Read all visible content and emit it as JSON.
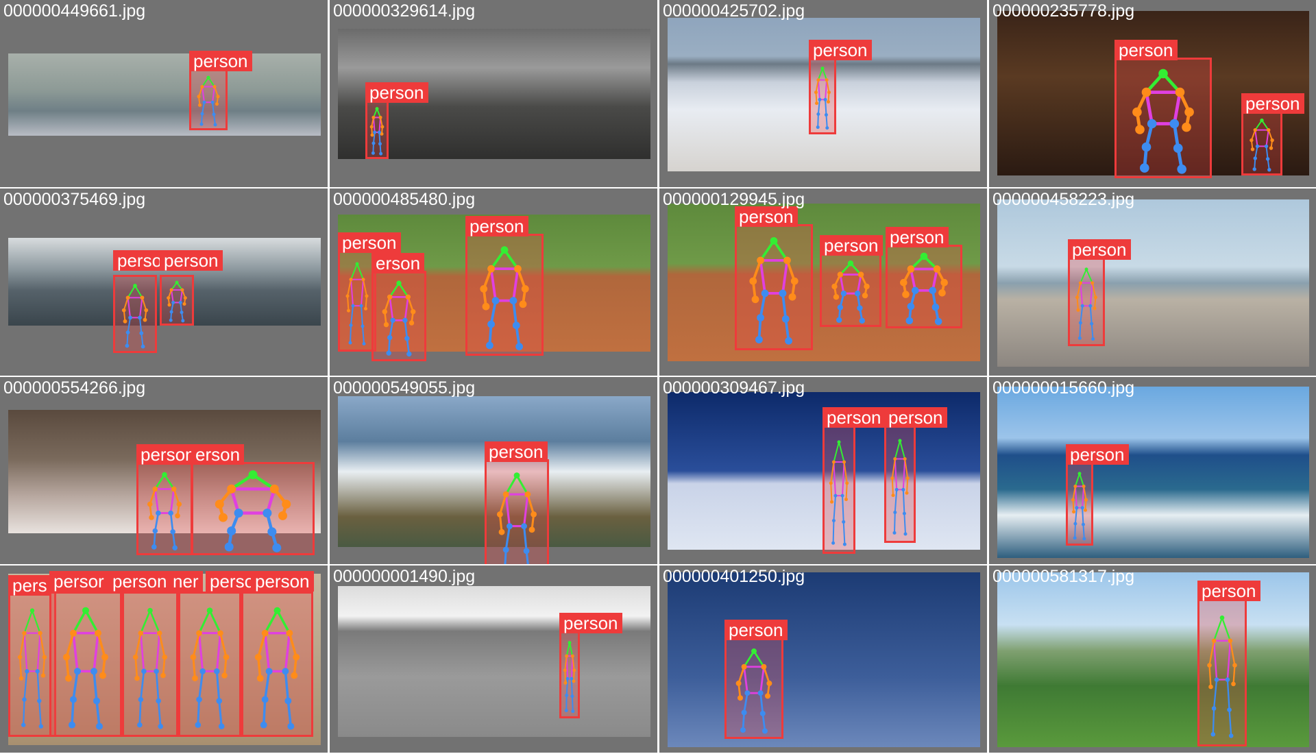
{
  "colors": {
    "background": "#ffffff",
    "tile": "#727272",
    "box": "#ee3b3b",
    "label_text": "#ffffff",
    "kp_face": "#33ee33",
    "kp_arm": "#ff8c1a",
    "kp_leg": "#3d8cf0",
    "kp_torso": "#e040e0"
  },
  "tiles": [
    {
      "filename": "000000449661.jpg",
      "scene": "hospital-room",
      "detections": [
        {
          "label": "person"
        }
      ]
    },
    {
      "filename": "000000329614.jpg",
      "scene": "cathedral-street",
      "detections": [
        {
          "label": "person"
        }
      ]
    },
    {
      "filename": "000000425702.jpg",
      "scene": "beach-surfboard",
      "detections": [
        {
          "label": "person"
        }
      ]
    },
    {
      "filename": "000000235778.jpg",
      "scene": "kites-bunting",
      "detections": [
        {
          "label": "person"
        },
        {
          "label": "person"
        }
      ]
    },
    {
      "filename": "000000375469.jpg",
      "scene": "ocean-wave-surfing",
      "detections": [
        {
          "label": "perso"
        },
        {
          "label": "person"
        }
      ]
    },
    {
      "filename": "000000485480.jpg",
      "scene": "baseball-field",
      "detections": [
        {
          "label": "person"
        },
        {
          "label": "erson"
        },
        {
          "label": "person"
        }
      ]
    },
    {
      "filename": "000000129945.jpg",
      "scene": "baseball-field",
      "detections": [
        {
          "label": "person"
        },
        {
          "label": "person"
        },
        {
          "label": "person"
        }
      ]
    },
    {
      "filename": "000000458223.jpg",
      "scene": "lighthouse-pier",
      "detections": [
        {
          "label": "person"
        }
      ]
    },
    {
      "filename": "000000554266.jpg",
      "scene": "bedroom",
      "detections": [
        {
          "label": "person"
        },
        {
          "label": "erson"
        }
      ]
    },
    {
      "filename": "000000549055.jpg",
      "scene": "wave-splash-surfer",
      "detections": [
        {
          "label": "person"
        }
      ]
    },
    {
      "filename": "000000309467.jpg",
      "scene": "snow-slope-night",
      "detections": [
        {
          "label": "person"
        },
        {
          "label": "person"
        }
      ]
    },
    {
      "filename": "000000015660.jpg",
      "scene": "windsurf-sea",
      "detections": [
        {
          "label": "person"
        }
      ]
    },
    {
      "filename": "",
      "scene": "group-photo",
      "detections": [
        {
          "label": "pers"
        },
        {
          "label": "persor"
        },
        {
          "label": "person"
        },
        {
          "label": "ner"
        },
        {
          "label": "perso"
        },
        {
          "label": "person"
        }
      ]
    },
    {
      "filename": "000000001490.jpg",
      "scene": "paddleboard-bw",
      "detections": [
        {
          "label": "person"
        }
      ]
    },
    {
      "filename": "000000401250.jpg",
      "scene": "skier-sky",
      "detections": [
        {
          "label": "person"
        }
      ]
    },
    {
      "filename": "000000581317.jpg",
      "scene": "hillside-meadow",
      "detections": [
        {
          "label": "person"
        }
      ]
    }
  ]
}
